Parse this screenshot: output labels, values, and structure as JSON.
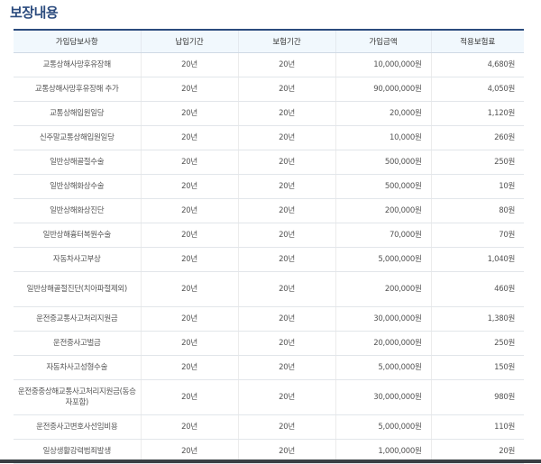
{
  "section": {
    "title": "보장내용"
  },
  "table": {
    "headers": [
      "가입담보사항",
      "납입기간",
      "보험기간",
      "가입금액",
      "적용보험료"
    ],
    "rows": [
      [
        "교통상해사망후유장해",
        "20년",
        "20년",
        "10,000,000원",
        "4,680원"
      ],
      [
        "교통상해사망후유장해 추가",
        "20년",
        "20년",
        "90,000,000원",
        "4,050원"
      ],
      [
        "교통상해입원일당",
        "20년",
        "20년",
        "20,000원",
        "1,120원"
      ],
      [
        "신주말교통상해입원일당",
        "20년",
        "20년",
        "10,000원",
        "260원"
      ],
      [
        "일반상해골절수술",
        "20년",
        "20년",
        "500,000원",
        "250원"
      ],
      [
        "일반상해화상수술",
        "20년",
        "20년",
        "500,000원",
        "10원"
      ],
      [
        "일반상해화상진단",
        "20년",
        "20년",
        "200,000원",
        "80원"
      ],
      [
        "일반상해흉터복원수술",
        "20년",
        "20년",
        "70,000원",
        "70원"
      ],
      [
        "자동차사고부상",
        "20년",
        "20년",
        "5,000,000원",
        "1,040원"
      ],
      [
        "일반상해골절진단(치아파절제외)",
        "20년",
        "20년",
        "200,000원",
        "460원"
      ],
      [
        "운전중교통사고처리지원금",
        "20년",
        "20년",
        "30,000,000원",
        "1,380원"
      ],
      [
        "운전중사고벌금",
        "20년",
        "20년",
        "20,000,000원",
        "250원"
      ],
      [
        "자동차사고성형수술",
        "20년",
        "20년",
        "5,000,000원",
        "150원"
      ],
      [
        "운전중중상해교통사고처리지원금(동승자포함)",
        "20년",
        "20년",
        "30,000,000원",
        "980원"
      ],
      [
        "운전중사고변호사선임비용",
        "20년",
        "20년",
        "5,000,000원",
        "110원"
      ],
      [
        "일상생활강력범죄발생",
        "20년",
        "20년",
        "1,000,000원",
        "20원"
      ]
    ]
  }
}
